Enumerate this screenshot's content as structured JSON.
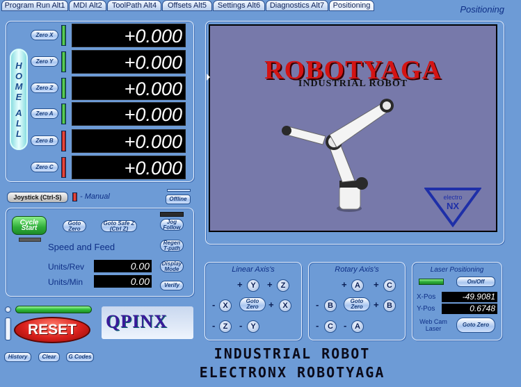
{
  "tabs": [
    "Program Run Alt1",
    "MDI Alt2",
    "ToolPath Alt4",
    "Offsets Alt5",
    "Settings Alt6",
    "Diagnostics Alt7",
    "Positioning"
  ],
  "screen_title": "Positioning",
  "home_all": [
    "H",
    "O",
    "M",
    "E",
    "",
    "A",
    "L",
    "L"
  ],
  "axes": [
    {
      "zero_label": "Zero X",
      "value": "+0.000",
      "led": "green"
    },
    {
      "zero_label": "Zero Y",
      "value": "+0.000",
      "led": "green"
    },
    {
      "zero_label": "Zero Z",
      "value": "+0.000",
      "led": "green"
    },
    {
      "zero_label": "Zero A",
      "value": "+0.000",
      "led": "green"
    },
    {
      "zero_label": "Zero B",
      "value": "+0.000",
      "led": "red"
    },
    {
      "zero_label": "Zero C",
      "value": "+0.000",
      "led": "red"
    }
  ],
  "joystick": {
    "button": "Joystick (Ctrl-S)",
    "mode": "- Manual",
    "offline": "Offline"
  },
  "controls": {
    "cycle_start": "Cycle Start",
    "goto_zero": "Goto Zero",
    "goto_safe_z": "Goto Safe Z (Ctrl Z)",
    "jog_follow": "Jog Follow",
    "regen_tpath": "Regen T-path",
    "display_mode": "Display Mode",
    "verify": "Verify",
    "speed_feed_title": "Speed and Feed",
    "units_rev_label": "Units/Rev",
    "units_rev_value": "0.00",
    "units_min_label": "Units/Min",
    "units_min_value": "0.00"
  },
  "reset": {
    "label": "RESET",
    "history": "History",
    "clear": "Clear",
    "gcodes": "G Codes"
  },
  "brand": "QPINX",
  "viewport": {
    "title": "ROBOTYAGA",
    "subtitle": "INDUSTRIAL ROBOT",
    "badge_text": "electro",
    "badge_nx": "NX"
  },
  "linear_axis": {
    "title": "Linear Axis's",
    "goto_zero": "Goto Zero",
    "buttons": [
      "+",
      "Y",
      "+",
      "Z",
      "-",
      "X",
      "+",
      "X",
      "-",
      "Z",
      "-",
      "Y"
    ]
  },
  "rotary_axis": {
    "title": "Rotary Axis's",
    "goto_zero": "Goto Zero",
    "buttons": [
      "+",
      "A",
      "+",
      "C",
      "-",
      "B",
      "+",
      "B",
      "-",
      "C",
      "-",
      "A"
    ]
  },
  "laser": {
    "title": "Laser Positioning",
    "on_off": "On/Off",
    "xpos_label": "X-Pos",
    "xpos_value": "-49.9081",
    "ypos_label": "Y-Pos",
    "ypos_value": "0.6748",
    "webcam_label": "Web Cam Laser",
    "goto_zero": "Goto Zero"
  },
  "footer": {
    "line1": "INDUSTRIAL ROBOT",
    "line2": "ELECTRONX ROBOTYAGA"
  },
  "colors": {
    "background": "#6d9bd6",
    "dro_bg": "#000000",
    "reset": "#d9201c",
    "cycle_start": "#2fae3a",
    "logo_red": "#d41414"
  }
}
